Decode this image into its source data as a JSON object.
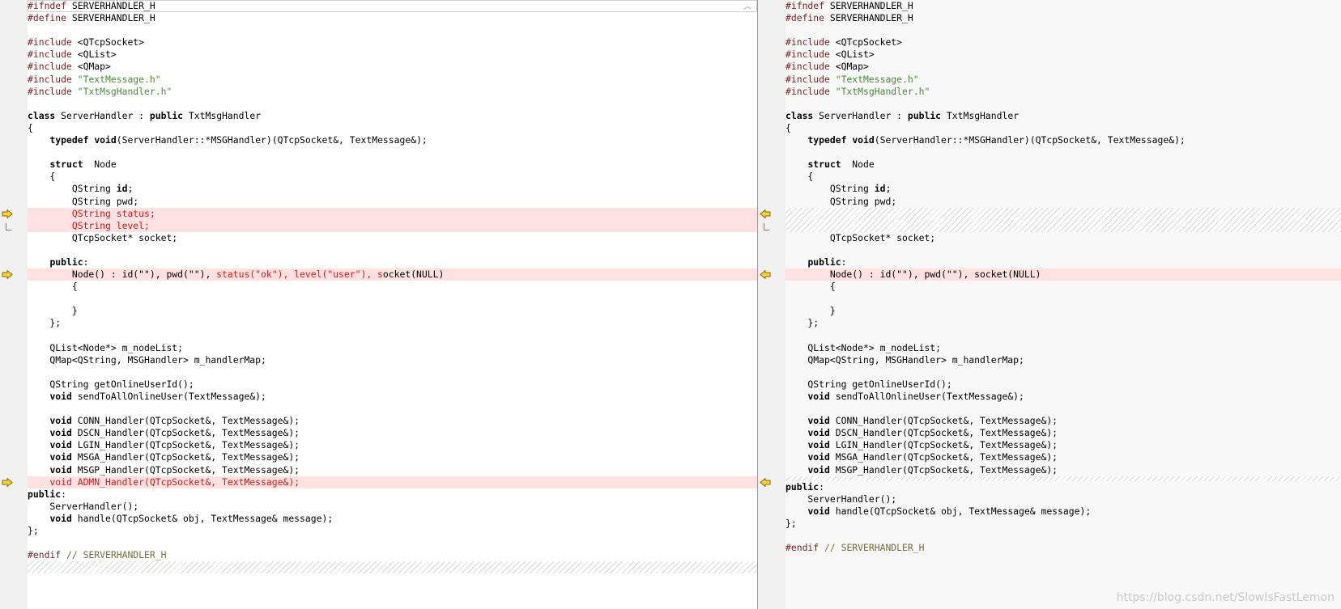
{
  "left": {
    "lines": [
      {
        "parts": [
          [
            "pp",
            "#ifndef "
          ],
          [
            "",
            "SERVERHANDLER_H"
          ]
        ],
        "state": "box"
      },
      {
        "parts": [
          [
            "pp",
            "#define "
          ],
          [
            "",
            "SERVERHANDLER_H"
          ]
        ]
      },
      {
        "parts": []
      },
      {
        "parts": [
          [
            "pp",
            "#include "
          ],
          [
            "",
            "<QTcpSocket>"
          ]
        ]
      },
      {
        "parts": [
          [
            "pp",
            "#include "
          ],
          [
            "",
            "<QList>"
          ]
        ]
      },
      {
        "parts": [
          [
            "pp",
            "#include "
          ],
          [
            "",
            "<QMap>"
          ]
        ]
      },
      {
        "parts": [
          [
            "pp",
            "#include "
          ],
          [
            "str",
            "\"TextMessage.h\""
          ]
        ]
      },
      {
        "parts": [
          [
            "pp",
            "#include "
          ],
          [
            "str",
            "\"TxtMsgHandler.h\""
          ]
        ]
      },
      {
        "parts": []
      },
      {
        "parts": [
          [
            "kw",
            "class"
          ],
          [
            "",
            " ServerHandler : "
          ],
          [
            "kw",
            "public"
          ],
          [
            "",
            " TxtMsgHandler"
          ]
        ]
      },
      {
        "parts": [
          [
            "",
            "{"
          ]
        ]
      },
      {
        "parts": [
          [
            "",
            "    "
          ],
          [
            "kw",
            "typedef"
          ],
          [
            "",
            " "
          ],
          [
            "kw",
            "void"
          ],
          [
            "",
            "(ServerHandler::*MSGHandler)(QTcpSocket&, TextMessage&);"
          ]
        ]
      },
      {
        "parts": []
      },
      {
        "parts": [
          [
            "",
            "    "
          ],
          [
            "kw",
            "struct"
          ],
          [
            "",
            "  Node"
          ]
        ]
      },
      {
        "parts": [
          [
            "",
            "    {"
          ]
        ]
      },
      {
        "parts": [
          [
            "",
            "        QString "
          ],
          [
            "kw",
            "id"
          ],
          [
            "",
            ";"
          ]
        ]
      },
      {
        "parts": [
          [
            "",
            "        QString pwd;"
          ]
        ]
      },
      {
        "parts": [
          [
            "rd",
            "        QString status;"
          ]
        ],
        "state": "changed",
        "arrow": true
      },
      {
        "parts": [
          [
            "rd",
            "        QString level;"
          ]
        ],
        "state": "changed"
      },
      {
        "parts": [
          [
            "",
            "        QTcpSocket* socket;"
          ]
        ]
      },
      {
        "parts": []
      },
      {
        "parts": [
          [
            "",
            "    "
          ],
          [
            "kw",
            "public"
          ],
          [
            "",
            ":"
          ]
        ]
      },
      {
        "parts": [
          [
            "",
            "        Node() : id(\"\"), pwd(\"\"), "
          ],
          [
            "rd",
            "status(\"ok\"), level(\"user\"), s"
          ],
          [
            "",
            "ocket(NULL)"
          ]
        ],
        "state": "changed",
        "arrow": true
      },
      {
        "parts": [
          [
            "",
            "        {"
          ]
        ]
      },
      {
        "parts": []
      },
      {
        "parts": [
          [
            "",
            "        }"
          ]
        ]
      },
      {
        "parts": [
          [
            "",
            "    };"
          ]
        ]
      },
      {
        "parts": []
      },
      {
        "parts": [
          [
            "",
            "    QList<Node*> m_nodeList;"
          ]
        ]
      },
      {
        "parts": [
          [
            "",
            "    QMap<QString, MSGHandler> m_handlerMap;"
          ]
        ]
      },
      {
        "parts": []
      },
      {
        "parts": [
          [
            "",
            "    QString getOnlineUserId();"
          ]
        ]
      },
      {
        "parts": [
          [
            "",
            "    "
          ],
          [
            "kw",
            "void"
          ],
          [
            "",
            " sendToAllOnlineUser(TextMessage&);"
          ]
        ]
      },
      {
        "parts": []
      },
      {
        "parts": [
          [
            "",
            "    "
          ],
          [
            "kw",
            "void"
          ],
          [
            "",
            " CONN_Handler(QTcpSocket&, TextMessage&);"
          ]
        ]
      },
      {
        "parts": [
          [
            "",
            "    "
          ],
          [
            "kw",
            "void"
          ],
          [
            "",
            " DSCN_Handler(QTcpSocket&, TextMessage&);"
          ]
        ]
      },
      {
        "parts": [
          [
            "",
            "    "
          ],
          [
            "kw",
            "void"
          ],
          [
            "",
            " LGIN_Handler(QTcpSocket&, TextMessage&);"
          ]
        ]
      },
      {
        "parts": [
          [
            "",
            "    "
          ],
          [
            "kw",
            "void"
          ],
          [
            "",
            " MSGA_Handler(QTcpSocket&, TextMessage&);"
          ]
        ]
      },
      {
        "parts": [
          [
            "",
            "    "
          ],
          [
            "kw",
            "void"
          ],
          [
            "",
            " MSGP_Handler(QTcpSocket&, TextMessage&);"
          ]
        ]
      },
      {
        "parts": [
          [
            "rd",
            "    void ADMN_Handler(QTcpSocket&, TextMessage&);"
          ]
        ],
        "state": "changed",
        "arrow": true
      },
      {
        "parts": [
          [
            "kw",
            "public"
          ],
          [
            "",
            ":"
          ]
        ]
      },
      {
        "parts": [
          [
            "",
            "    ServerHandler();"
          ]
        ]
      },
      {
        "parts": [
          [
            "",
            "    "
          ],
          [
            "kw",
            "void"
          ],
          [
            "",
            " handle(QTcpSocket& obj, TextMessage& message);"
          ]
        ]
      },
      {
        "parts": [
          [
            "",
            "};"
          ]
        ]
      },
      {
        "parts": []
      },
      {
        "parts": [
          [
            "pp",
            "#endif "
          ],
          [
            "cm",
            "// SERVERHANDLER_H"
          ]
        ]
      },
      {
        "parts": [],
        "state": "hatch"
      }
    ]
  },
  "right": {
    "lines": [
      {
        "parts": [
          [
            "pp",
            "#ifndef "
          ],
          [
            "",
            "SERVERHANDLER_H"
          ]
        ]
      },
      {
        "parts": [
          [
            "pp",
            "#define "
          ],
          [
            "",
            "SERVERHANDLER_H"
          ]
        ]
      },
      {
        "parts": []
      },
      {
        "parts": [
          [
            "pp",
            "#include "
          ],
          [
            "",
            "<QTcpSocket>"
          ]
        ]
      },
      {
        "parts": [
          [
            "pp",
            "#include "
          ],
          [
            "",
            "<QList>"
          ]
        ]
      },
      {
        "parts": [
          [
            "pp",
            "#include "
          ],
          [
            "",
            "<QMap>"
          ]
        ]
      },
      {
        "parts": [
          [
            "pp",
            "#include "
          ],
          [
            "str",
            "\"TextMessage.h\""
          ]
        ]
      },
      {
        "parts": [
          [
            "pp",
            "#include "
          ],
          [
            "str",
            "\"TxtMsgHandler.h\""
          ]
        ]
      },
      {
        "parts": []
      },
      {
        "parts": [
          [
            "kw",
            "class"
          ],
          [
            "",
            " ServerHandler : "
          ],
          [
            "kw",
            "public"
          ],
          [
            "",
            " TxtMsgHandler"
          ]
        ]
      },
      {
        "parts": [
          [
            "",
            "{"
          ]
        ]
      },
      {
        "parts": [
          [
            "",
            "    "
          ],
          [
            "kw",
            "typedef"
          ],
          [
            "",
            " "
          ],
          [
            "kw",
            "void"
          ],
          [
            "",
            "(ServerHandler::*MSGHandler)(QTcpSocket&, TextMessage&);"
          ]
        ]
      },
      {
        "parts": []
      },
      {
        "parts": [
          [
            "",
            "    "
          ],
          [
            "kw",
            "struct"
          ],
          [
            "",
            "  Node"
          ]
        ]
      },
      {
        "parts": [
          [
            "",
            "    {"
          ]
        ]
      },
      {
        "parts": [
          [
            "",
            "        QString "
          ],
          [
            "kw",
            "id"
          ],
          [
            "",
            ";"
          ]
        ]
      },
      {
        "parts": [
          [
            "",
            "        QString pwd;"
          ]
        ]
      },
      {
        "parts": [],
        "state": "hatch",
        "arrow": true
      },
      {
        "parts": [],
        "state": "hatch"
      },
      {
        "parts": [
          [
            "",
            "        QTcpSocket* socket;"
          ]
        ]
      },
      {
        "parts": []
      },
      {
        "parts": [
          [
            "",
            "    "
          ],
          [
            "kw",
            "public"
          ],
          [
            "",
            ":"
          ]
        ]
      },
      {
        "parts": [
          [
            "",
            "        Node() : id(\"\"), pwd(\"\"), socket(NULL)"
          ]
        ],
        "state": "changed",
        "arrow": true
      },
      {
        "parts": [
          [
            "",
            "        {"
          ]
        ]
      },
      {
        "parts": []
      },
      {
        "parts": [
          [
            "",
            "        }"
          ]
        ]
      },
      {
        "parts": [
          [
            "",
            "    };"
          ]
        ]
      },
      {
        "parts": []
      },
      {
        "parts": [
          [
            "",
            "    QList<Node*> m_nodeList;"
          ]
        ]
      },
      {
        "parts": [
          [
            "",
            "    QMap<QString, MSGHandler> m_handlerMap;"
          ]
        ]
      },
      {
        "parts": []
      },
      {
        "parts": [
          [
            "",
            "    QString getOnlineUserId();"
          ]
        ]
      },
      {
        "parts": [
          [
            "",
            "    "
          ],
          [
            "kw",
            "void"
          ],
          [
            "",
            " sendToAllOnlineUser(TextMessage&);"
          ]
        ]
      },
      {
        "parts": []
      },
      {
        "parts": [
          [
            "",
            "    "
          ],
          [
            "kw",
            "void"
          ],
          [
            "",
            " CONN_Handler(QTcpSocket&, TextMessage&);"
          ]
        ]
      },
      {
        "parts": [
          [
            "",
            "    "
          ],
          [
            "kw",
            "void"
          ],
          [
            "",
            " DSCN_Handler(QTcpSocket&, TextMessage&);"
          ]
        ]
      },
      {
        "parts": [
          [
            "",
            "    "
          ],
          [
            "kw",
            "void"
          ],
          [
            "",
            " LGIN_Handler(QTcpSocket&, TextMessage&);"
          ]
        ]
      },
      {
        "parts": [
          [
            "",
            "    "
          ],
          [
            "kw",
            "void"
          ],
          [
            "",
            " MSGA_Handler(QTcpSocket&, TextMessage&);"
          ]
        ]
      },
      {
        "parts": [
          [
            "",
            "    "
          ],
          [
            "kw",
            "void"
          ],
          [
            "",
            " MSGP_Handler(QTcpSocket&, TextMessage&);"
          ]
        ]
      },
      {
        "parts": [],
        "state": "hatch-thin",
        "arrow": true
      },
      {
        "parts": [
          [
            "kw",
            "public"
          ],
          [
            "",
            ":"
          ]
        ]
      },
      {
        "parts": [
          [
            "",
            "    ServerHandler();"
          ]
        ]
      },
      {
        "parts": [
          [
            "",
            "    "
          ],
          [
            "kw",
            "void"
          ],
          [
            "",
            " handle(QTcpSocket& obj, TextMessage& message);"
          ]
        ]
      },
      {
        "parts": [
          [
            "",
            "};"
          ]
        ]
      },
      {
        "parts": []
      },
      {
        "parts": [
          [
            "pp",
            "#endif "
          ],
          [
            "cm",
            "// SERVERHANDLER_H"
          ]
        ]
      }
    ]
  },
  "icons": {
    "left_arrow": "diff-arrow-right-icon",
    "right_arrow": "diff-arrow-left-icon",
    "scroll_up": "chevron-up-icon"
  },
  "scroll_up_glyph": "︿",
  "watermark": "https://blog.csdn.net/SlowIsFastLemon",
  "colors": {
    "changed_bg": "#ffe1e1",
    "removed_text": "#d11a1a",
    "string": "#4a8a3a",
    "preprocessor": "#7a1e1e",
    "arrow_fill": "#f3d43a"
  }
}
